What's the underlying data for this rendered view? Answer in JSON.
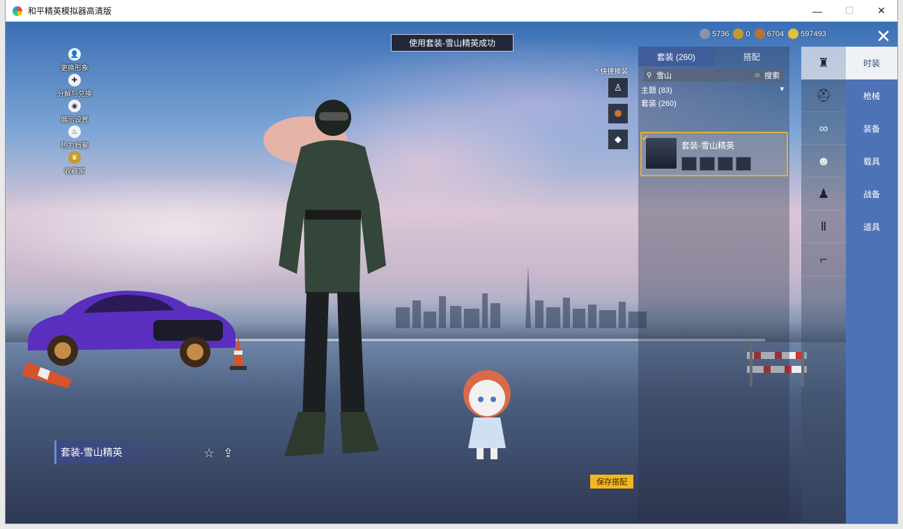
{
  "window": {
    "title": "和平精英模拟器高清版",
    "controls": {
      "minimize": "—",
      "maximize": "☐",
      "close": "✕"
    }
  },
  "toast": "使用套装-雪山精英成功",
  "left_menu": [
    {
      "label": "更换形象",
      "icon": "person-icon"
    },
    {
      "label": "分解与兑换",
      "icon": "puzzle-icon"
    },
    {
      "label": "展示设置",
      "icon": "eye-icon"
    },
    {
      "label": "热力档案",
      "icon": "flame-icon"
    },
    {
      "label": "收藏家",
      "icon": "trophy-icon"
    }
  ],
  "currency": [
    {
      "icon": "coin-silver-icon",
      "value": "5736",
      "color": "#8a93a8"
    },
    {
      "icon": "coin-gold-icon",
      "value": "0",
      "color": "#c69a2b"
    },
    {
      "icon": "coin-bronze-icon",
      "value": "6704",
      "color": "#b9742f"
    },
    {
      "icon": "coin-yellow-icon",
      "value": "597493",
      "color": "#e2c03a"
    }
  ],
  "quick_swap": {
    "label": "快捷换装",
    "help": "?"
  },
  "panel": {
    "tabs": [
      {
        "label": "套装 (260)",
        "active": true
      },
      {
        "label": "搭配",
        "active": false
      }
    ],
    "search": {
      "value": "雪山",
      "button": "搜索"
    },
    "filter": {
      "label": "主题 (83)",
      "arrow": "▾"
    },
    "section": "套装 (260)",
    "item": {
      "name": "套装-雪山精英"
    }
  },
  "icon_strip": [
    {
      "icon": "outfit-icon",
      "active": true
    },
    {
      "icon": "helmet-icon",
      "active": false
    },
    {
      "icon": "goggles-icon",
      "active": false
    },
    {
      "icon": "mask-icon",
      "active": false
    },
    {
      "icon": "jacket-icon",
      "active": false
    },
    {
      "icon": "pants-icon",
      "active": false
    },
    {
      "icon": "boots-icon",
      "active": false
    }
  ],
  "categories": [
    {
      "label": "时装",
      "active": true
    },
    {
      "label": "枪械",
      "active": false
    },
    {
      "label": "装备",
      "active": false
    },
    {
      "label": "载具",
      "active": false
    },
    {
      "label": "战备",
      "active": false
    },
    {
      "label": "道具",
      "active": false
    }
  ],
  "outfit_name": "套装-雪山精英",
  "save_button": "保存搭配",
  "colors": {
    "accent": "#4d72b6",
    "gold": "#f3b722",
    "panel_tab": "#3f5d9a"
  }
}
